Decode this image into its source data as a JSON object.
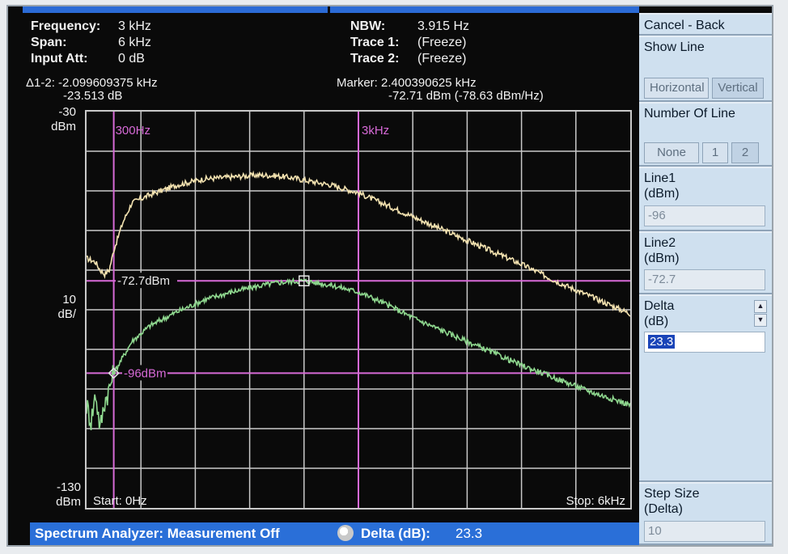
{
  "header": {
    "frequency_label": "Frequency:",
    "frequency_value": "3 kHz",
    "span_label": "Span:",
    "span_value": "6 kHz",
    "input_att_label": "Input Att:",
    "input_att_value": "0 dB",
    "nbw_label": "NBW:",
    "nbw_value": "3.915 Hz",
    "trace1_label": "Trace 1:",
    "trace1_value": "(Freeze)",
    "trace2_label": "Trace 2:",
    "trace2_value": "(Freeze)"
  },
  "markers": {
    "delta_line1": "Δ1-2: -2.099609375 kHz",
    "delta_line2": "-23.513 dB",
    "marker_line1": "Marker: 2.400390625 kHz",
    "marker_line2": "-72.71 dBm (-78.63 dBm/Hz)"
  },
  "axes": {
    "ytop_value": "-30",
    "ytop_unit": "dBm",
    "yscale_value": "10",
    "yscale_unit": "dB/",
    "ybottom_value": "-130",
    "ybottom_unit": "dBm",
    "start_label": "Start: 0Hz",
    "stop_label": "Stop: 6kHz"
  },
  "plot": {
    "vline1_label": "300Hz",
    "vline2_label": "3kHz",
    "hline1_label": "-72.7dBm",
    "hline2_label": "-96dBm"
  },
  "chart_data": {
    "type": "line",
    "x_unit": "Hz",
    "y_unit": "dBm",
    "xlim": [
      0,
      6000
    ],
    "ylim": [
      -130,
      -30
    ],
    "grid": true,
    "series": [
      {
        "name": "Trace 1",
        "color": "#f3e2b0",
        "x": [
          0,
          100,
          150,
          200,
          250,
          300,
          400,
          500,
          700,
          1000,
          1300,
          1600,
          1900,
          2100,
          2300,
          2400,
          2700,
          3000,
          3300,
          3600,
          4000,
          4400,
          4800,
          5200,
          5600,
          6000
        ],
        "y": [
          -67,
          -68,
          -70,
          -71,
          -70,
          -65,
          -58,
          -53,
          -51,
          -48.5,
          -47,
          -46.5,
          -46,
          -46.2,
          -46.8,
          -47.3,
          -48.5,
          -50.5,
          -53.5,
          -56.5,
          -60.5,
          -64.5,
          -68.5,
          -73,
          -77,
          -81
        ]
      },
      {
        "name": "Trace 2",
        "color": "#8fd88f",
        "x": [
          0,
          50,
          100,
          150,
          200,
          250,
          300,
          350,
          400,
          500,
          700,
          1000,
          1300,
          1600,
          1900,
          2100,
          2300,
          2400,
          2700,
          3000,
          3300,
          3600,
          4000,
          4400,
          4800,
          5200,
          5600,
          6000
        ],
        "y": [
          -104,
          -108,
          -101,
          -110,
          -103,
          -100,
          -96,
          -94,
          -92,
          -88,
          -84,
          -80.5,
          -77.5,
          -75.5,
          -74,
          -73.2,
          -72.8,
          -72.7,
          -73.8,
          -75.5,
          -78.5,
          -82,
          -86,
          -90,
          -94,
          -97.5,
          -101,
          -104
        ]
      }
    ],
    "markers": [
      {
        "x": 2400,
        "y": -72.7,
        "shape": "square"
      },
      {
        "x": 300,
        "y": -96,
        "shape": "diamond"
      }
    ],
    "reference_lines": {
      "vertical_hz": [
        300,
        3000
      ],
      "horizontal_dbm": [
        -72.7,
        -96
      ]
    }
  },
  "status": {
    "text": "Spectrum Analyzer: Measurement Off",
    "delta_label": "Delta (dB):",
    "delta_value": "23.3"
  },
  "softkeys": {
    "cancel_back": "Cancel - Back",
    "show_line": "Show Line",
    "horizontal": "Horizontal",
    "vertical": "Vertical",
    "number_of_line": "Number Of Line",
    "none": "None",
    "one": "1",
    "two": "2",
    "line1_label_a": "Line1",
    "line1_label_b": "(dBm)",
    "line1_value": "-96",
    "line2_label_a": "Line2",
    "line2_label_b": "(dBm)",
    "line2_value": "-72.7",
    "delta_label_a": "Delta",
    "delta_label_b": "(dB)",
    "delta_value": "23.3",
    "step_label_a": "Step Size",
    "step_label_b": "(Delta)",
    "step_value": "10"
  },
  "colors": {
    "trace1": "#f3e2b0",
    "trace2": "#8fd88f",
    "reference_line": "#d76ad7",
    "status_bar": "#2a6fd8",
    "panel": "#cfe0ef"
  }
}
